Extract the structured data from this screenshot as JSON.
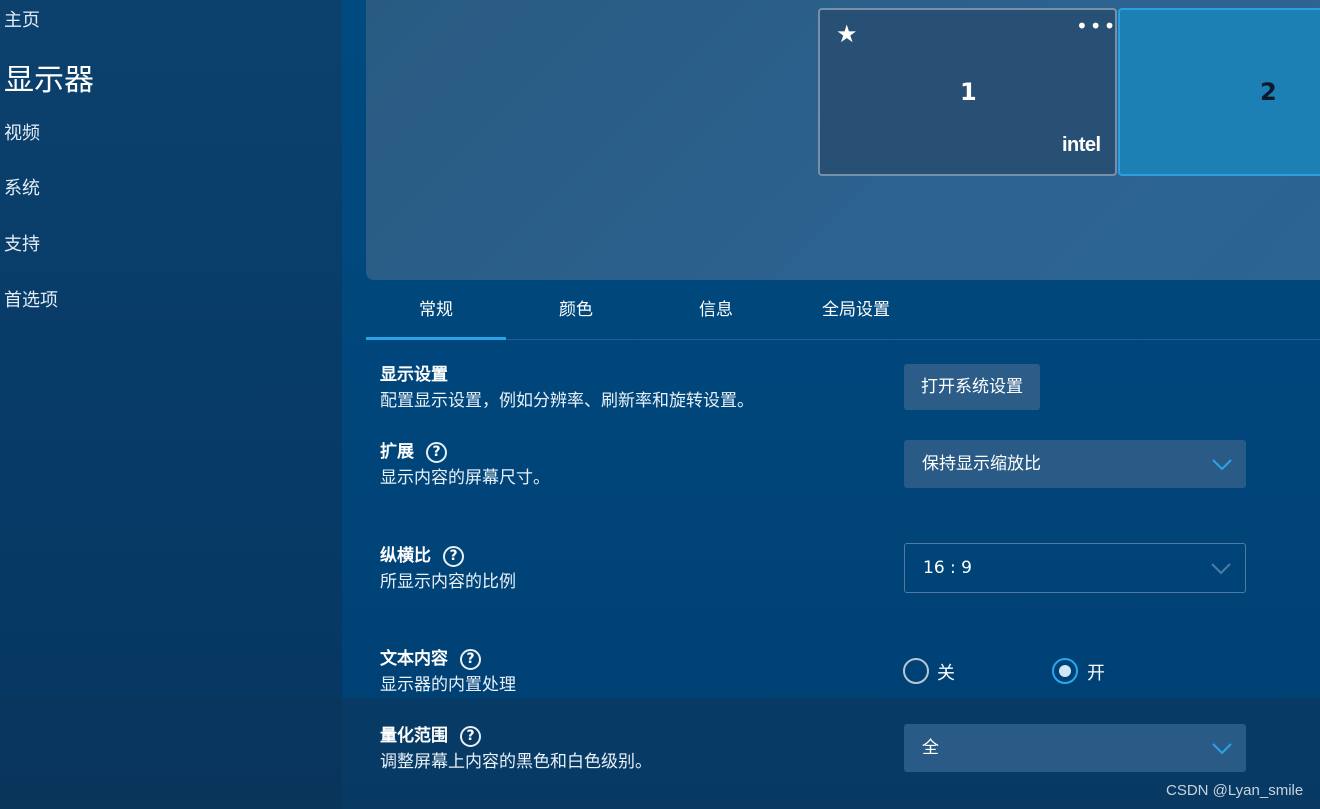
{
  "sidebar": {
    "items": [
      {
        "label": "主页"
      },
      {
        "label": "显示器"
      },
      {
        "label": "视频"
      },
      {
        "label": "系统"
      },
      {
        "label": "支持"
      },
      {
        "label": "首选项"
      }
    ]
  },
  "preview": {
    "monitors": [
      {
        "number": "1",
        "brand": "intel"
      },
      {
        "number": "2"
      }
    ]
  },
  "tabs": [
    {
      "label": "常规",
      "active": true
    },
    {
      "label": "颜色"
    },
    {
      "label": "信息"
    },
    {
      "label": "全局设置"
    }
  ],
  "settings": {
    "display": {
      "title": "显示设置",
      "desc": "配置显示设置，例如分辨率、刷新率和旋转设置。",
      "button": "打开系统设置"
    },
    "scaling": {
      "title": "扩展",
      "desc": "显示内容的屏幕尺寸。",
      "value": "保持显示缩放比"
    },
    "aspect": {
      "title": "纵横比",
      "desc": "所显示内容的比例",
      "value": "16 : 9"
    },
    "text_content": {
      "title": "文本内容",
      "desc": "显示器的内置处理",
      "off_label": "关",
      "on_label": "开",
      "selected": "开"
    },
    "quant_range": {
      "title": "量化范围",
      "desc": "调整屏幕上内容的黑色和白色级别。",
      "value": "全"
    }
  },
  "watermark": "CSDN @Lyan_smile",
  "colors": {
    "accent": "#2aa4e6",
    "background": "#00467b",
    "sidebar": "#073a66"
  }
}
